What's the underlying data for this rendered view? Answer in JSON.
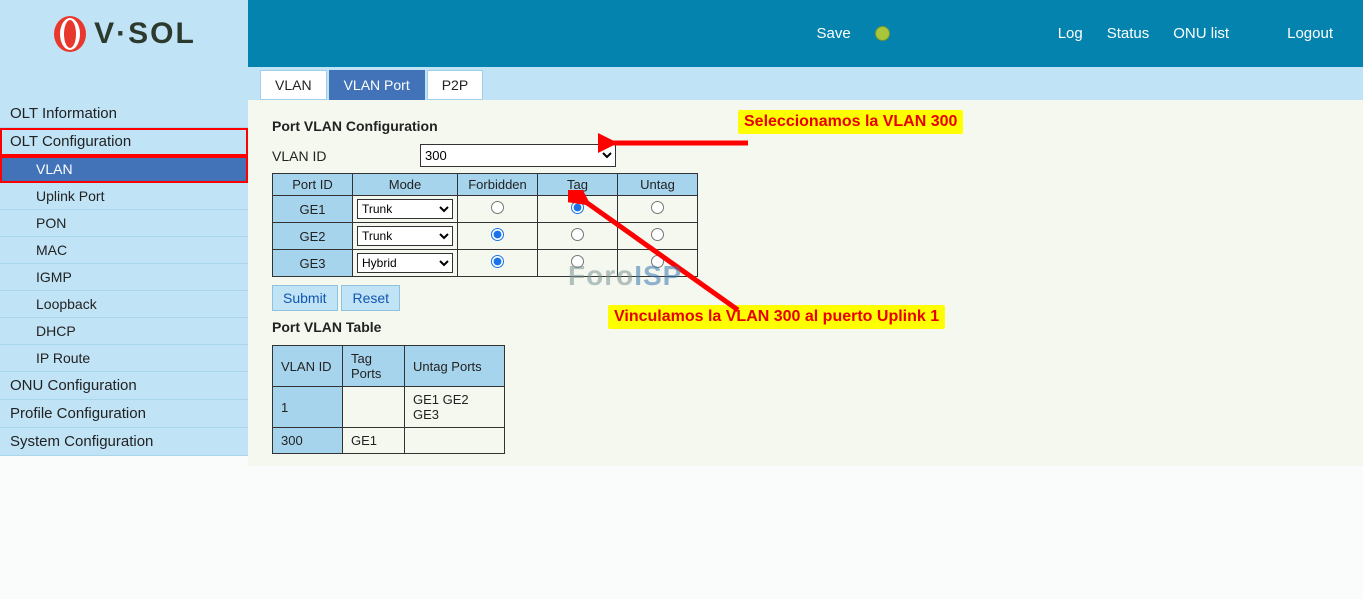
{
  "brand": "V·SOL",
  "header": {
    "save": "Save",
    "links": {
      "log": "Log",
      "status": "Status",
      "onulist": "ONU list",
      "logout": "Logout"
    }
  },
  "tabs": {
    "vlan": "VLAN",
    "vlanport": "VLAN Port",
    "p2p": "P2P"
  },
  "sidebar": {
    "olt_info": "OLT Information",
    "olt_config": "OLT Configuration",
    "olt_config_sub": {
      "vlan": "VLAN",
      "uplink": "Uplink Port",
      "pon": "PON",
      "mac": "MAC",
      "igmp": "IGMP",
      "loopback": "Loopback",
      "dhcp": "DHCP",
      "iproute": "IP Route"
    },
    "onu_config": "ONU Configuration",
    "profile_config": "Profile Configuration",
    "system_config": "System Configuration"
  },
  "content": {
    "title": "Port VLAN Configuration",
    "vlan_id_label": "VLAN ID",
    "vlan_id_value": "300",
    "config_headers": {
      "port": "Port ID",
      "mode": "Mode",
      "forbidden": "Forbidden",
      "tag": "Tag",
      "untag": "Untag"
    },
    "rows": [
      {
        "port": "GE1",
        "mode": "Trunk",
        "sel": "tag"
      },
      {
        "port": "GE2",
        "mode": "Trunk",
        "sel": "forbidden"
      },
      {
        "port": "GE3",
        "mode": "Hybrid",
        "sel": "forbidden"
      }
    ],
    "buttons": {
      "submit": "Submit",
      "reset": "Reset"
    },
    "table_title": "Port VLAN Table",
    "table_headers": {
      "vlan": "VLAN ID",
      "tag": "Tag Ports",
      "untag": "Untag Ports"
    },
    "table_rows": [
      {
        "vlan": "1",
        "tag": "",
        "untag": "GE1 GE2 GE3"
      },
      {
        "vlan": "300",
        "tag": "GE1",
        "untag": ""
      }
    ]
  },
  "annotations": {
    "a1": "Seleccionamos la VLAN 300",
    "a2": "Vinculamos la VLAN 300 al puerto Uplink 1"
  },
  "watermark": "ForoISP"
}
